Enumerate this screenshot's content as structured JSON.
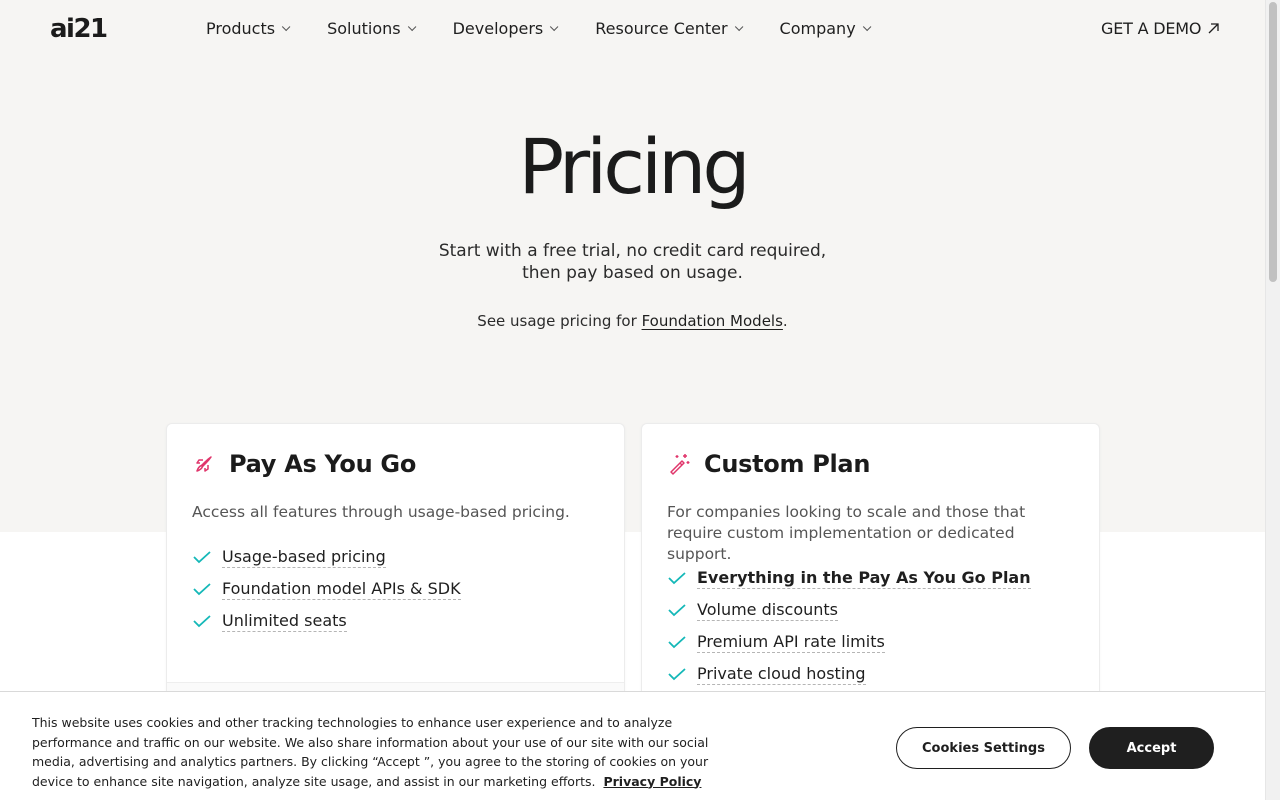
{
  "header": {
    "logo": "ai21",
    "nav": [
      "Products",
      "Solutions",
      "Developers",
      "Resource Center",
      "Company"
    ],
    "cta_label": "GET A DEMO"
  },
  "hero": {
    "title": "Pricing",
    "subtitle_line1": "Start with a free trial, no credit card required,",
    "subtitle_line2": "then pay based on usage.",
    "usage_prefix": "See usage pricing for",
    "usage_link": "Foundation Models",
    "usage_suffix": "."
  },
  "plans": {
    "payg": {
      "title": "Pay As You Go",
      "description": "Access all features through usage-based pricing.",
      "features": [
        "Usage-based pricing",
        "Foundation model APIs & SDK",
        "Unlimited seats"
      ]
    },
    "custom": {
      "title": "Custom Plan",
      "description": "For companies looking to scale and those that require custom implementation or dedicated support.",
      "features": [
        "Everything in the Pay As You Go Plan",
        "Volume discounts",
        "Premium API rate limits",
        "Private cloud hosting"
      ]
    }
  },
  "cookie": {
    "text": "This website uses cookies and other tracking technologies to enhance user experience and to analyze performance and traffic on our website. We also share information about your use of our site with our social media, advertising and analytics partners. By clicking “Accept ”, you agree to the storing of cookies on your device to enhance site navigation, analyze site usage, and assist in our marketing efforts.",
    "privacy_link": "Privacy Policy",
    "settings_label": "Cookies Settings",
    "accept_label": "Accept"
  },
  "colors": {
    "hero_bg": "#f6f5f3",
    "check": "#14b8b8",
    "icon_accent": "#e0356b",
    "dark": "#1f1f1f"
  },
  "icons": {
    "payg": "rocket-icon",
    "custom": "magic-wand-icon",
    "feature": "check-icon",
    "cta": "arrow-up-right-icon"
  }
}
